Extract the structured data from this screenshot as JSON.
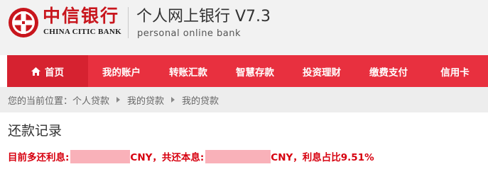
{
  "header": {
    "bank_name_cn": "中信银行",
    "bank_name_en": "CHINA CITIC BANK",
    "product_title": "个人网上银行 V7.3",
    "product_subtitle": "personal online bank",
    "brand_color": "#c8161d"
  },
  "nav": {
    "color": "#e8303f",
    "active_color": "#d62230",
    "items": [
      {
        "label": "首页",
        "icon": "home-icon",
        "active": true
      },
      {
        "label": "我的账户"
      },
      {
        "label": "转账汇款"
      },
      {
        "label": "智慧存款"
      },
      {
        "label": "投资理财"
      },
      {
        "label": "缴费支付"
      },
      {
        "label": "信用卡"
      }
    ]
  },
  "breadcrumb": {
    "prefix": "您的当前位置：",
    "items": [
      "个人贷款",
      "我的贷款",
      "我的贷款"
    ]
  },
  "page": {
    "title": "还款记录",
    "summary": {
      "part1": "目前多还利息:",
      "part2": "CNY，共还本息:",
      "part3": "CNY，利息占比9.51%",
      "color": "#d7000f",
      "mask_color": "#f9b1b9"
    }
  }
}
